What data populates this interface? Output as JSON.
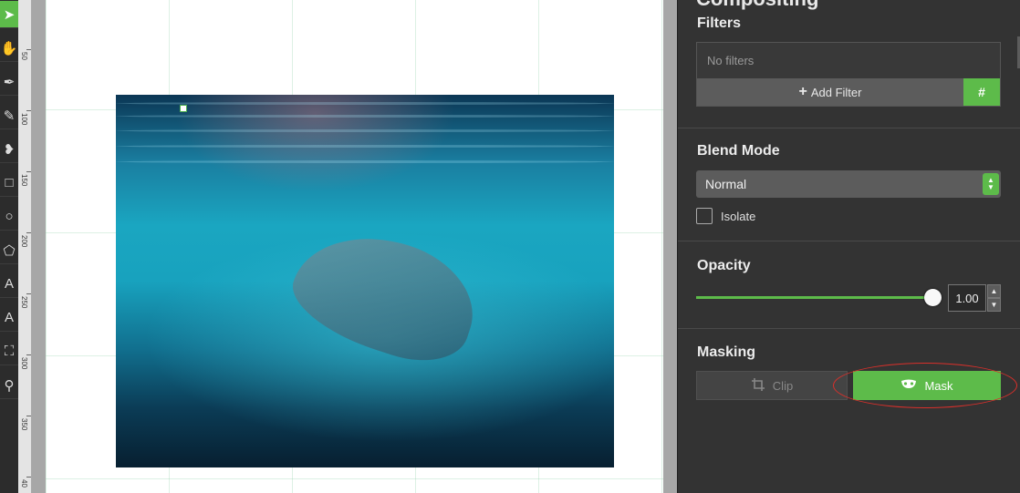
{
  "toolbar": {
    "tools": [
      {
        "name": "select-arrow-icon",
        "glyph": "➤",
        "active": true
      },
      {
        "name": "hand-icon",
        "glyph": "✋",
        "active": false
      },
      {
        "name": "pen-icon",
        "glyph": "✒",
        "active": false
      },
      {
        "name": "pencil-icon",
        "glyph": "✎",
        "active": false
      },
      {
        "name": "brush-icon",
        "glyph": "❥",
        "active": false
      },
      {
        "name": "rectangle-icon",
        "glyph": "□",
        "active": false
      },
      {
        "name": "ellipse-icon",
        "glyph": "○",
        "active": false
      },
      {
        "name": "polygon-icon",
        "glyph": "⬠",
        "active": false
      },
      {
        "name": "text-icon",
        "glyph": "A",
        "active": false
      },
      {
        "name": "text-path-icon",
        "glyph": "A",
        "active": false
      },
      {
        "name": "crop-icon",
        "glyph": "⛶",
        "active": false
      },
      {
        "name": "zoom-icon",
        "glyph": "⚲",
        "active": false
      }
    ]
  },
  "ruler": {
    "labels": [
      "50",
      "100",
      "150",
      "200",
      "250",
      "300",
      "350",
      "40"
    ]
  },
  "panel": {
    "title": "Compositing",
    "filters": {
      "label": "Filters",
      "empty_text": "No filters",
      "add_label": "Add Filter",
      "hash_label": "#"
    },
    "blend": {
      "label": "Blend Mode",
      "value": "Normal",
      "isolate_label": "Isolate"
    },
    "opacity": {
      "label": "Opacity",
      "value": "1.00",
      "level": 1.0
    },
    "masking": {
      "label": "Masking",
      "clip_label": "Clip",
      "mask_label": "Mask"
    }
  },
  "colors": {
    "accent": "#5dbb4a",
    "highlight": "#d9302b"
  }
}
